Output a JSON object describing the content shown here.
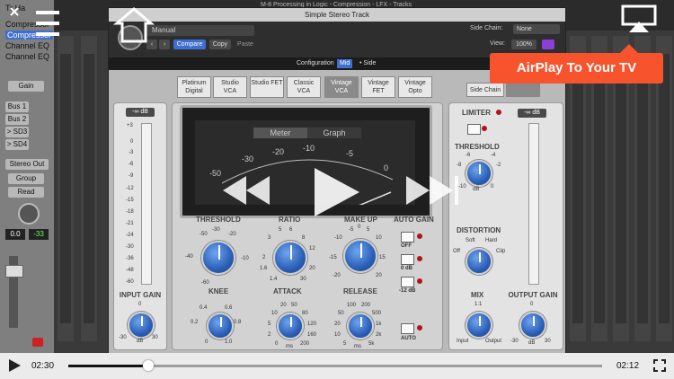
{
  "daw": {
    "window_title": "M-8 Processing in Logic - Compression - LFX - Tracks",
    "track_header": "Tr Ha",
    "left_panel": {
      "plugin_slots": [
        "Compressor",
        "Compressor",
        "Channel EQ",
        "Channel EQ"
      ],
      "gain_label": "Gain",
      "sends": [
        "Bus 1",
        "Bus 2",
        "> SD3",
        "> SD4"
      ],
      "output": "Stereo Out",
      "group": "Group",
      "automation": "Read",
      "values": [
        "0.0",
        "-33"
      ]
    }
  },
  "plugin": {
    "title": "Simple Stereo Track",
    "preset": "Manual",
    "compare_label": "Compare",
    "copy_label": "Copy",
    "paste_label": "Paste",
    "side_chain_label": "Side Chain:",
    "side_chain_value": "None",
    "view_label": "View:",
    "view_value": "100%",
    "modes": [
      "Configuration",
      "Mid",
      "• Side"
    ],
    "compressor_types": [
      {
        "label": "Platinum Digital",
        "active": false
      },
      {
        "label": "Studio VCA",
        "active": false
      },
      {
        "label": "Studio FET",
        "active": false
      },
      {
        "label": "Classic VCA",
        "active": false
      },
      {
        "label": "Vintage VCA",
        "active": true
      },
      {
        "label": "Vintage FET",
        "active": false
      },
      {
        "label": "Vintage Opto",
        "active": false
      }
    ],
    "side_chain_button": "Side Chain",
    "input_meter_readout": "-∞ dB",
    "input_scale": [
      "+3",
      "0",
      "-3",
      "-6",
      "-9",
      "-12",
      "-15",
      "-18",
      "-21",
      "-24",
      "-30",
      "-36",
      "-48",
      "-60"
    ],
    "meter_tabs": [
      "Meter",
      "Graph"
    ],
    "vu_scale": [
      "-50",
      "-30",
      "-20",
      "-10",
      "-5",
      "0"
    ],
    "controls": {
      "threshold": {
        "label": "THRESHOLD",
        "scale": [
          "-50",
          "-30",
          "-20",
          "-10",
          "-40",
          "-60"
        ]
      },
      "ratio": {
        "label": "RATIO",
        "scale": [
          "5",
          "6",
          "8",
          "3",
          "12",
          "2",
          "1.6",
          "20",
          "1.4",
          "30"
        ]
      },
      "makeup": {
        "label": "MAKE UP",
        "scale": [
          "-5",
          "0",
          "5",
          "-10",
          "10",
          "-15",
          "15",
          "-20",
          "20"
        ]
      },
      "auto_gain": {
        "label": "AUTO GAIN",
        "options": [
          "OFF",
          "0 dB",
          "-12 dB"
        ]
      },
      "knee": {
        "label": "KNEE",
        "scale": [
          "0.4",
          "0.6",
          "0.2",
          "0.8",
          "0",
          "1.0"
        ]
      },
      "attack": {
        "label": "ATTACK",
        "scale": [
          "20",
          "50",
          "10",
          "80",
          "5",
          "120",
          "2",
          "160",
          "0",
          "200"
        ],
        "unit": "ms"
      },
      "release": {
        "label": "RELEASE",
        "scale": [
          "100",
          "200",
          "50",
          "500",
          "20",
          "1k",
          "10",
          "2k",
          "5",
          "5k"
        ],
        "unit": "ms"
      },
      "auto": {
        "label": "AUTO"
      },
      "input_gain": {
        "label": "INPUT GAIN",
        "scale": [
          "0",
          "-30",
          "30"
        ],
        "unit": "dB"
      },
      "limiter": {
        "label": "LIMITER"
      },
      "limiter_threshold": {
        "label": "THRESHOLD",
        "scale": [
          "-6",
          "-4",
          "-8",
          "-2",
          "-10",
          "0"
        ],
        "unit": "dB"
      },
      "distortion": {
        "label": "DISTORTION",
        "scale": [
          "Soft",
          "Hard",
          "Off",
          "Clip"
        ]
      },
      "mix": {
        "label": "MIX",
        "scale": [
          "1:1",
          "Input",
          "Output"
        ]
      },
      "output_gain": {
        "label": "OUTPUT GAIN",
        "scale": [
          "0",
          "-30",
          "30"
        ],
        "unit": "dB"
      }
    },
    "output_meter_readout": "-∞ dB"
  },
  "player": {
    "elapsed": "02:30",
    "remaining": "02:12",
    "progress": 0.15,
    "airplay_banner": "AirPlay To Your TV"
  },
  "colors": {
    "accent": "#3d6fd3",
    "airplay": "#f7532d",
    "knob": "#2b5fb8"
  }
}
